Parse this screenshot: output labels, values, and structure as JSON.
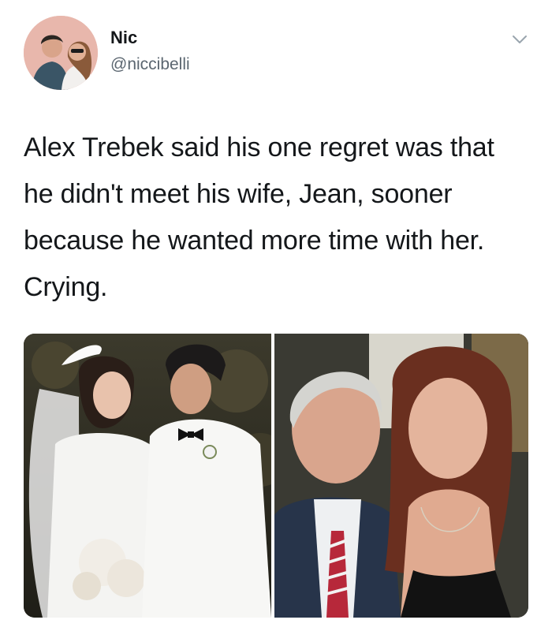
{
  "author": {
    "display_name": "Nic",
    "handle": "@niccibelli"
  },
  "tweet": {
    "text": "Alex Trebek said his one regret was that he didn't meet his wife, Jean, sooner because he wanted more time with her. Crying."
  },
  "icons": {
    "menu": "chevron-down-icon"
  },
  "colors": {
    "text": "#14171a",
    "secondary_text": "#5b6670",
    "caret": "#9aa5ae",
    "avatar_bg": "#e8b7ac"
  }
}
